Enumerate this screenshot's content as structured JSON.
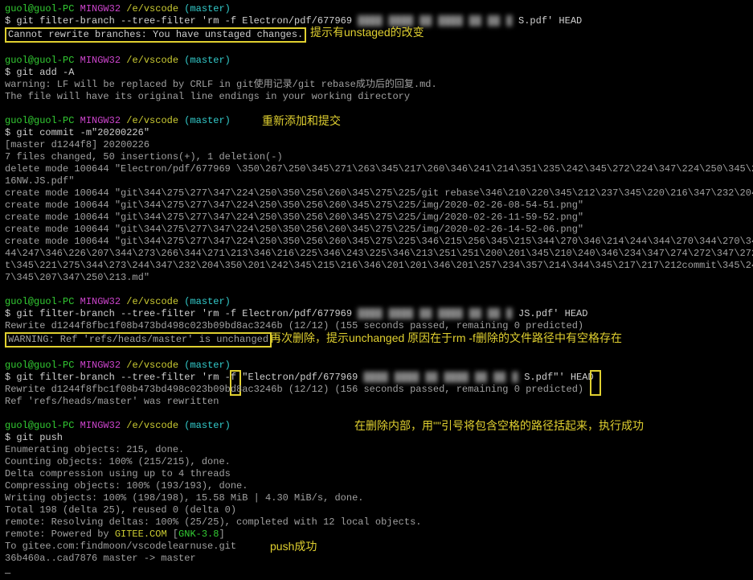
{
  "prompt": {
    "user": "guol@guol-PC",
    "shell": "MINGW32",
    "path": "/e/vscode",
    "branch": "(master)"
  },
  "blocks": {
    "b1": {
      "cmd": "$ git filter-branch --tree-filter 'rm -f Electron/pdf/677969 ",
      "cmd_tail": "S.pdf' HEAD",
      "err": "Cannot rewrite branches: You have unstaged changes.",
      "anno": "提示有unstaged的改变"
    },
    "b2": {
      "cmd": "$ git add -A",
      "l1": "warning: LF will be replaced by CRLF in git使用记录/git rebase成功后的回复.md.",
      "l2": "The file will have its original line endings in your working directory"
    },
    "b3": {
      "cmd": "$ git commit -m\"20200226\"",
      "anno": "重新添加和提交",
      "o1": "[master d1244f8] 20200226",
      "o2": " 7 files changed, 50 insertions(+), 1 deletion(-)",
      "o3": " delete mode 100644 \"Electron/pdf/677969 \\350\\267\\250\\345\\271\\263\\345\\217\\260\\346\\241\\214\\351\\235\\242\\345\\272\\224\\347\\224\\250\\345\\274\\",
      "o3b": "16NW.JS.pdf\"",
      "o4": " create mode 100644 \"git\\344\\275\\277\\347\\224\\250\\350\\256\\260\\345\\275\\225/git rebase\\346\\210\\220\\345\\212\\237\\345\\220\\216\\347\\232\\204\\34",
      "o5": " create mode 100644 \"git\\344\\275\\277\\347\\224\\250\\350\\256\\260\\345\\275\\225/img/2020-02-26-08-54-51.png\"",
      "o6": " create mode 100644 \"git\\344\\275\\277\\347\\224\\250\\350\\256\\260\\345\\275\\225/img/2020-02-26-11-59-52.png\"",
      "o7": " create mode 100644 \"git\\344\\275\\277\\347\\224\\250\\350\\256\\260\\345\\275\\225/img/2020-02-26-14-52-06.png\"",
      "o8": " create mode 100644 \"git\\344\\275\\277\\347\\224\\250\\350\\256\\260\\345\\275\\225\\346\\215\\256\\345\\215\\344\\270\\346\\214\\244\\344\\270\\344\\270\\347\\224\\347\\250\\",
      "o9": "44\\247\\346\\226\\207\\344\\273\\266\\344\\271\\213\\346\\216\\225\\346\\243\\225\\346\\213\\251\\251\\200\\201\\345\\210\\240\\346\\234\\347\\274\\272\\347\\272\\223\\345\\216\\",
      "o10": "t\\345\\221\\275\\344\\273\\244\\347\\232\\204\\350\\201\\242\\345\\215\\216\\346\\201\\201\\346\\201\\257\\234\\357\\214\\344\\345\\217\\217\\212commit\\345\\244\\247\\346\\2",
      "o11": "7\\345\\207\\347\\250\\213.md\""
    },
    "b4": {
      "cmd": "$ git filter-branch --tree-filter 'rm -f Electron/pdf/677969 ",
      "cmd_tail": "JS.pdf' HEAD",
      "o1": "Rewrite d1244f8fbc1f08b473bd498c023b09bd8ac3246b (12/12) (155 seconds passed, remaining 0 predicted)",
      "o2": "WARNING: Ref 'refs/heads/master' is unchanged",
      "anno": "再次删除，提示unchanged  原因在于rm -f删除的文件路径中有空格存在"
    },
    "b5": {
      "cmd1": "$ git filter-branch --tree-filter 'rm -f ",
      "cmd2": "\"",
      "cmd3": "Electron/pdf/677969 ",
      "cmd_tail": "S.pdf",
      "cmd4": "\"",
      "cmd5": "' HEAD",
      "o1": "Rewrite d1244f8fbc1f08b473bd498c023b09bd8ac3246b (12/12) (156 seconds passed, remaining 0 predicted)",
      "o2": "Ref 'refs/heads/master' was rewritten",
      "anno": "在删除内部，用\"\"引号将包含空格的路径括起来，执行成功"
    },
    "b6": {
      "cmd": "$ git push",
      "o1": "Enumerating objects: 215, done.",
      "o2": "Counting objects: 100% (215/215), done.",
      "o3": "Delta compression using up to 4 threads",
      "o4": "Compressing objects: 100% (193/193), done.",
      "o5": "Writing objects: 100% (198/198), 15.58 MiB | 4.30 MiB/s, done.",
      "o6": "Total 198 (delta 25), reused 0 (delta 0)",
      "o7": "remote: Resolving deltas: 100% (25/25), completed with 12 local objects.",
      "o8a": "remote: Powered by ",
      "o8b": "GITEE.COM",
      "o8c": " [",
      "o8d": "GNK-3.8",
      "o8e": "]",
      "o9": "To gitee.com:findmoon/vscodelearnuse.git",
      "o10": "   36b460a..cad7876  master -> master",
      "anno": "push成功"
    }
  },
  "blur_text": "████ ████ ██ ████ ██ ██ █"
}
